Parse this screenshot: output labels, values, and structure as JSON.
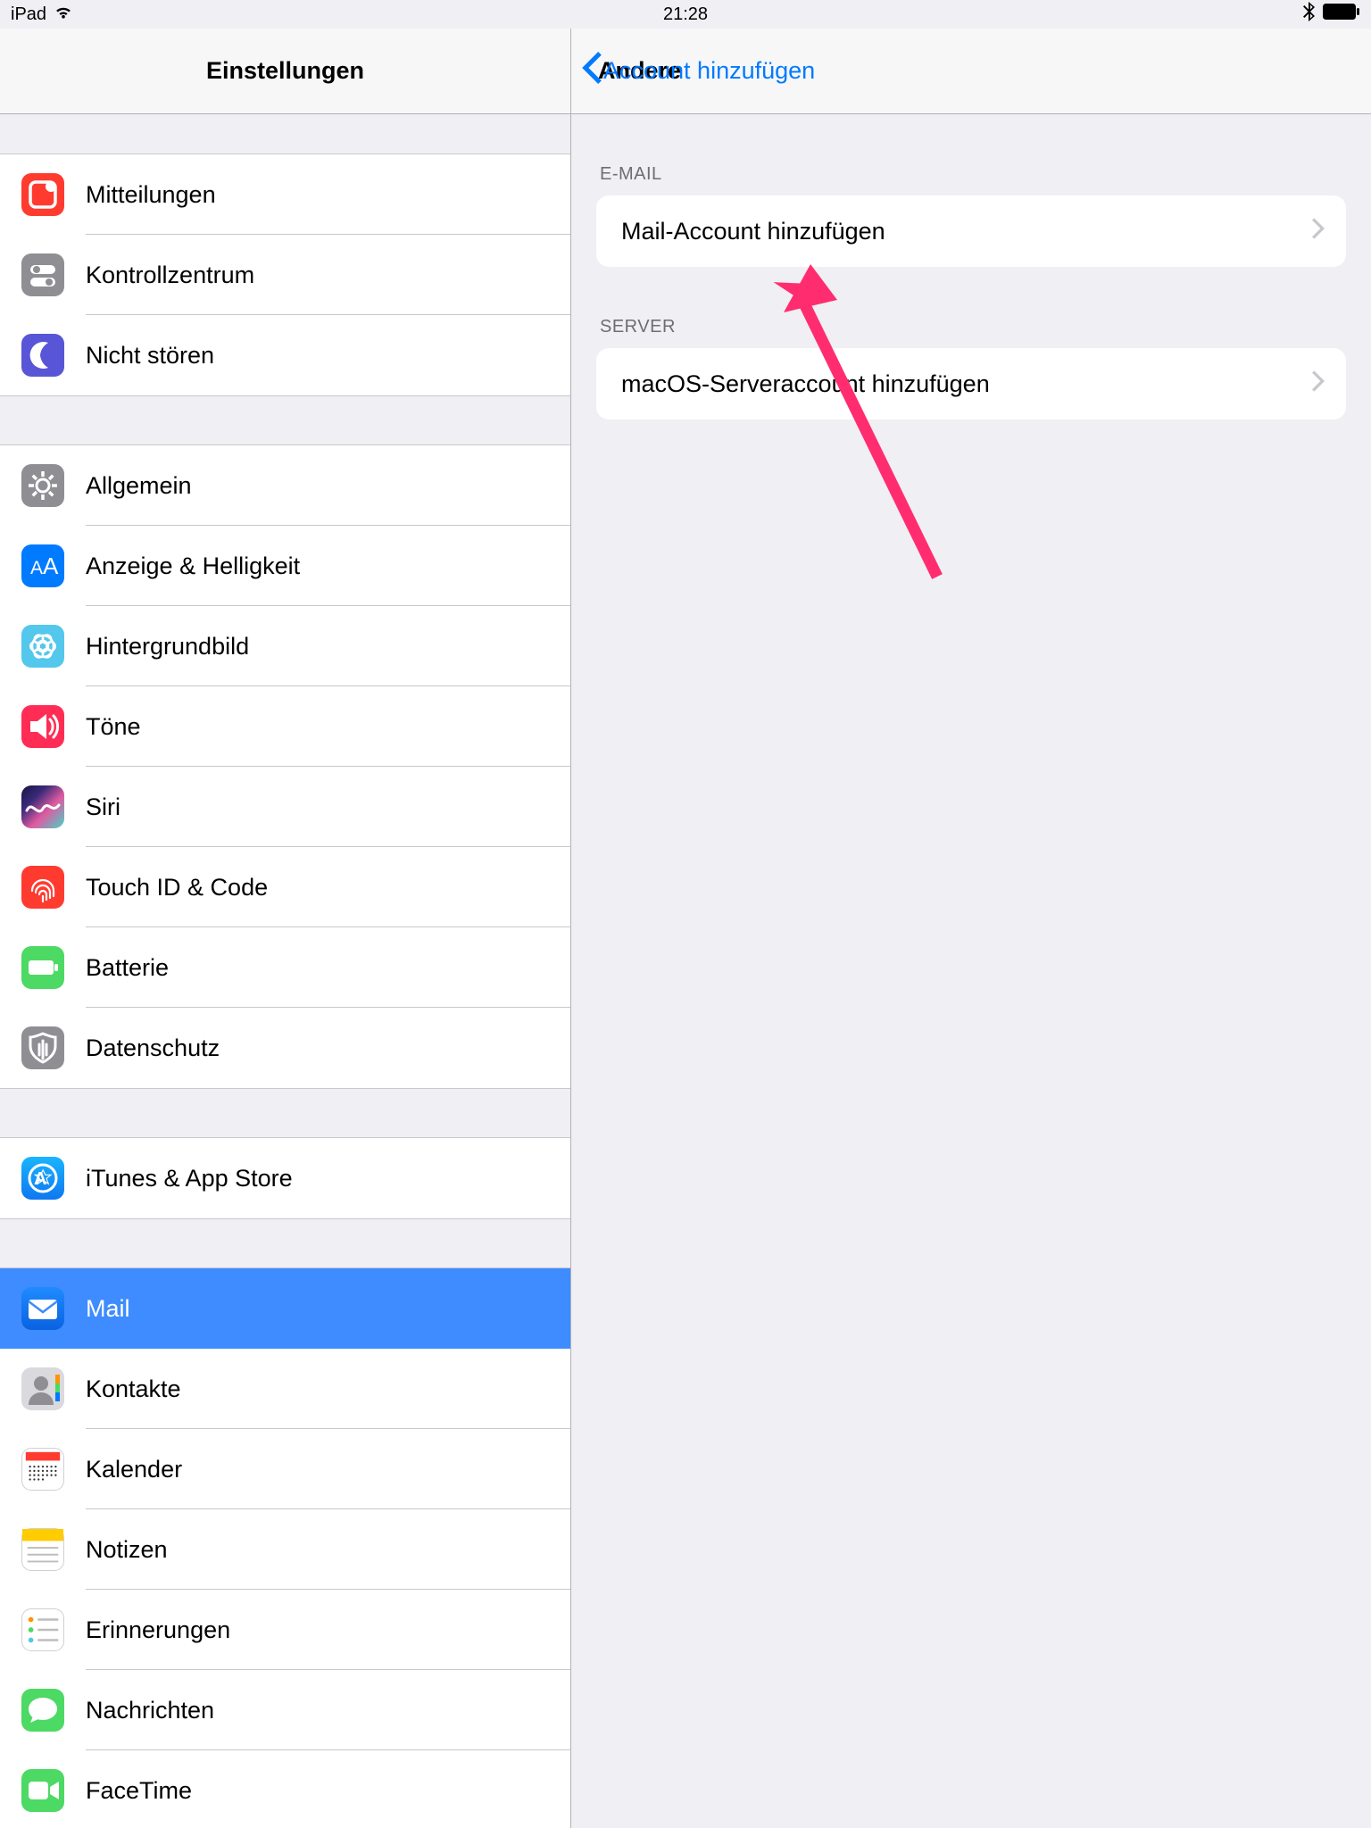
{
  "statusbar": {
    "device": "iPad",
    "time": "21:28"
  },
  "sidebar": {
    "title": "Einstellungen",
    "groups": [
      {
        "items": [
          {
            "id": "notifications",
            "label": "Mitteilungen"
          },
          {
            "id": "controlcenter",
            "label": "Kontrollzentrum"
          },
          {
            "id": "dnd",
            "label": "Nicht stören"
          }
        ]
      },
      {
        "items": [
          {
            "id": "general",
            "label": "Allgemein"
          },
          {
            "id": "display",
            "label": "Anzeige & Helligkeit"
          },
          {
            "id": "wallpaper",
            "label": "Hintergrundbild"
          },
          {
            "id": "sounds",
            "label": "Töne"
          },
          {
            "id": "siri",
            "label": "Siri"
          },
          {
            "id": "touchid",
            "label": "Touch ID & Code"
          },
          {
            "id": "battery",
            "label": "Batterie"
          },
          {
            "id": "privacy",
            "label": "Datenschutz"
          }
        ]
      },
      {
        "items": [
          {
            "id": "itunes",
            "label": "iTunes & App Store"
          }
        ]
      },
      {
        "items": [
          {
            "id": "mail",
            "label": "Mail",
            "selected": true
          },
          {
            "id": "contacts",
            "label": "Kontakte"
          },
          {
            "id": "calendar",
            "label": "Kalender"
          },
          {
            "id": "notes",
            "label": "Notizen"
          },
          {
            "id": "reminders",
            "label": "Erinnerungen"
          },
          {
            "id": "messages",
            "label": "Nachrichten"
          },
          {
            "id": "facetime",
            "label": "FaceTime"
          }
        ]
      }
    ]
  },
  "detail": {
    "back_label": "Account hinzufügen",
    "title": "Andere",
    "sections": [
      {
        "header": "E-MAIL",
        "rows": [
          {
            "id": "add-mail",
            "label": "Mail-Account hinzufügen"
          }
        ]
      },
      {
        "header": "SERVER",
        "rows": [
          {
            "id": "add-macos-server",
            "label": "macOS-Serveraccount hinzufügen"
          }
        ]
      }
    ]
  }
}
